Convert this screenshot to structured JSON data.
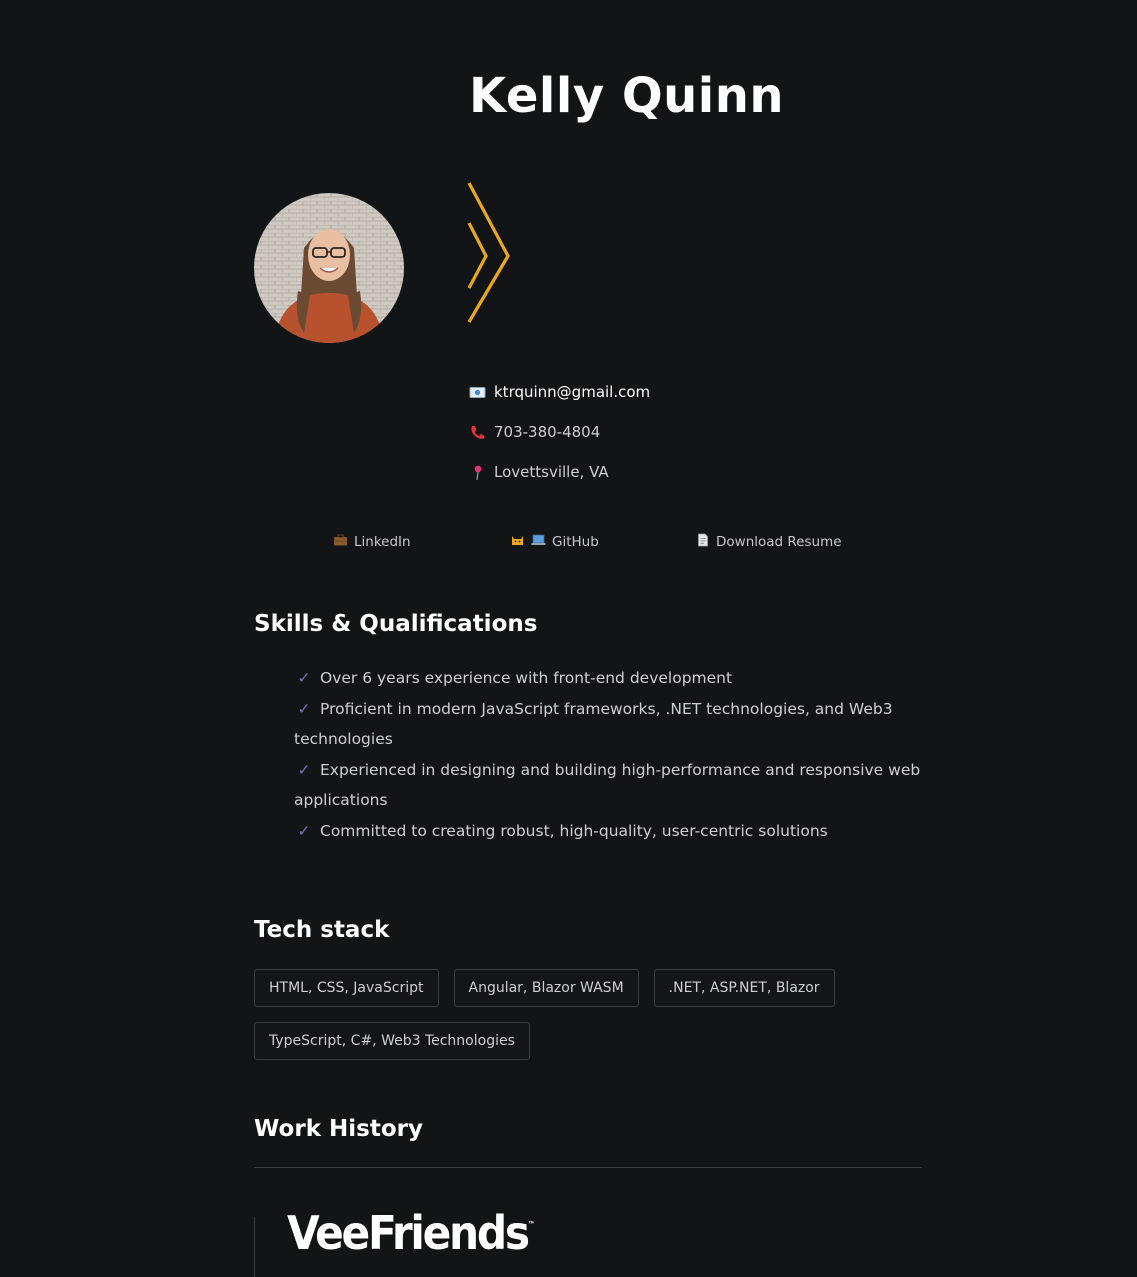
{
  "profile": {
    "name": "Kelly Quinn",
    "email": "ktrquinn@gmail.com",
    "phone": "703-380-4804",
    "location": "Lovettsville, VA"
  },
  "links": {
    "linkedin": "LinkedIn",
    "github": "GitHub",
    "resume": "Download Resume"
  },
  "icons": {
    "email": "envelope-icon",
    "phone": "phone-icon",
    "location": "pin-icon",
    "linkedin": "briefcase-icon",
    "github": "cat-laptop-icon",
    "resume": "document-icon"
  },
  "skills": {
    "title": "Skills & Qualifications",
    "items": [
      "Over 6 years experience with front-end development",
      "Proficient in modern JavaScript frameworks, .NET technologies, and Web3 technologies",
      "Experienced in designing and building high-performance and responsive web applications",
      "Committed to creating robust, high-quality, user-centric solutions"
    ]
  },
  "tech_stack": {
    "title": "Tech stack",
    "items": [
      "HTML, CSS, JavaScript",
      "Angular, Blazor WASM",
      ".NET, ASP.NET, Blazor",
      "TypeScript, C#, Web3 Technologies"
    ]
  },
  "work_history": {
    "title": "Work History",
    "jobs": [
      {
        "company_logo_text": "VeeFriends"
      }
    ]
  },
  "colors": {
    "background": "#131416",
    "accent_gold": "#e8a91c",
    "check_purple": "#7c6bb8"
  }
}
